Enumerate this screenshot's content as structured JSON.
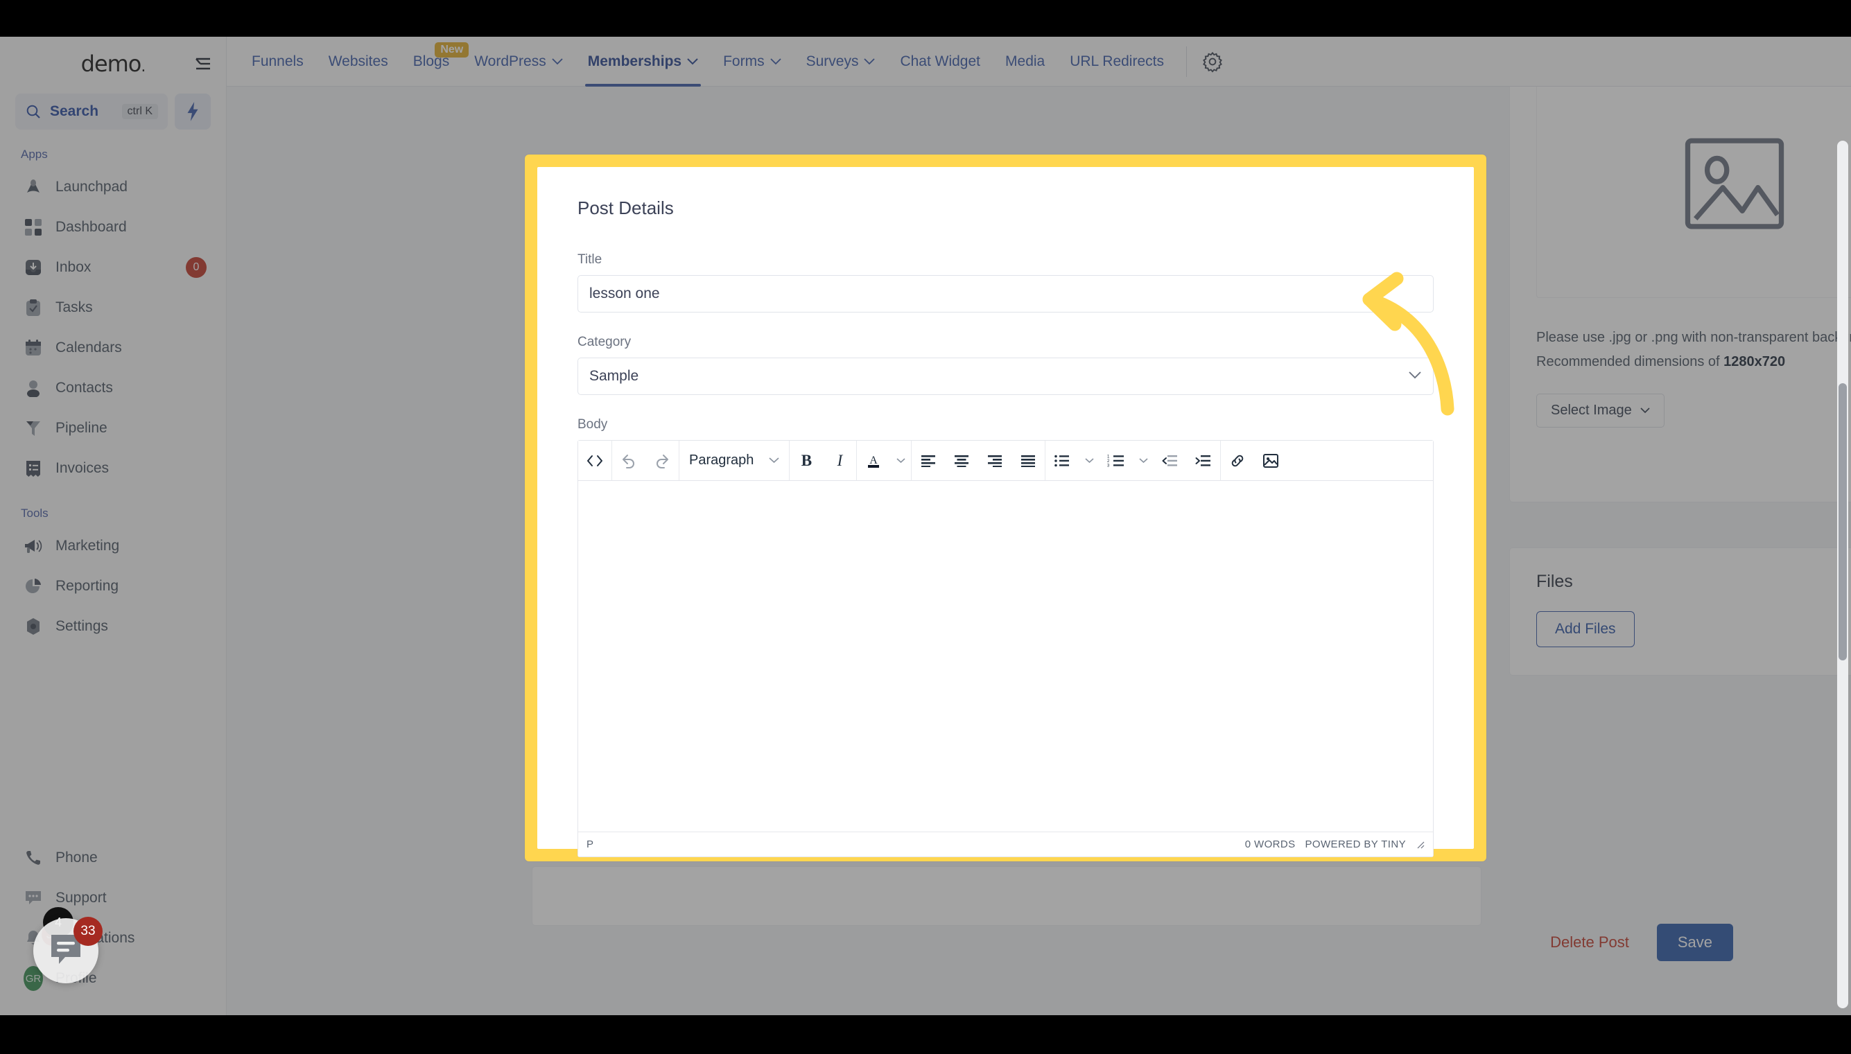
{
  "sidebar": {
    "logo": "demo",
    "logo_suffix": ".",
    "search": {
      "label": "Search",
      "shortcut": "ctrl K"
    },
    "sections": [
      {
        "label": "Apps",
        "items": [
          {
            "label": "Launchpad",
            "icon": "launchpad-icon",
            "badge": ""
          },
          {
            "label": "Dashboard",
            "icon": "dashboard-icon",
            "badge": ""
          },
          {
            "label": "Inbox",
            "icon": "inbox-icon",
            "badge": "0"
          },
          {
            "label": "Tasks",
            "icon": "tasks-icon",
            "badge": ""
          },
          {
            "label": "Calendars",
            "icon": "calendar-icon",
            "badge": ""
          },
          {
            "label": "Contacts",
            "icon": "contacts-icon",
            "badge": ""
          },
          {
            "label": "Pipeline",
            "icon": "pipeline-icon",
            "badge": ""
          },
          {
            "label": "Invoices",
            "icon": "invoices-icon",
            "badge": ""
          }
        ]
      },
      {
        "label": "Tools",
        "items": [
          {
            "label": "Marketing",
            "icon": "megaphone-icon",
            "badge": ""
          },
          {
            "label": "Reporting",
            "icon": "pie-chart-icon",
            "badge": ""
          },
          {
            "label": "Settings",
            "icon": "gear-icon",
            "badge": ""
          }
        ]
      }
    ],
    "bottom": [
      {
        "label": "Phone",
        "icon": "phone-icon",
        "badge": ""
      },
      {
        "label": "Support",
        "icon": "support-chat-icon",
        "badge": ""
      },
      {
        "label": "Notifications",
        "icon": "bell-icon",
        "badge": "33"
      },
      {
        "label": "Profile",
        "icon": "avatar-icon",
        "badge": "",
        "avatar_initials": "GR"
      }
    ]
  },
  "chat_widget": {
    "badge": "33",
    "mini_badge": "4"
  },
  "topnav": {
    "items": [
      {
        "label": "Funnels",
        "caret": false,
        "active": false,
        "badge": ""
      },
      {
        "label": "Websites",
        "caret": false,
        "active": false,
        "badge": ""
      },
      {
        "label": "Blogs",
        "caret": false,
        "active": false,
        "badge": "New"
      },
      {
        "label": "WordPress",
        "caret": true,
        "active": false,
        "badge": ""
      },
      {
        "label": "Memberships",
        "caret": true,
        "active": true,
        "badge": ""
      },
      {
        "label": "Forms",
        "caret": true,
        "active": false,
        "badge": ""
      },
      {
        "label": "Surveys",
        "caret": true,
        "active": false,
        "badge": ""
      },
      {
        "label": "Chat Widget",
        "caret": false,
        "active": false,
        "badge": ""
      },
      {
        "label": "Media",
        "caret": false,
        "active": false,
        "badge": ""
      },
      {
        "label": "URL Redirects",
        "caret": false,
        "active": false,
        "badge": ""
      }
    ],
    "settings_icon": "gear-icon"
  },
  "post_details": {
    "card_title": "Post Details",
    "title_label": "Title",
    "title_value": "lesson one",
    "title_placeholder": "Title",
    "category_label": "Category",
    "category_value": "Sample",
    "category_options": [
      "Sample"
    ],
    "body_label": "Body",
    "editor": {
      "format_select": "Paragraph",
      "buttons": [
        "source-code-icon",
        "undo-icon",
        "redo-icon",
        "bold-icon",
        "italic-icon",
        "text-color-icon",
        "align-left-icon",
        "align-center-icon",
        "align-right-icon",
        "align-justify-icon",
        "bullet-list-icon",
        "numbered-list-icon",
        "outdent-icon",
        "indent-icon",
        "link-icon",
        "image-icon"
      ],
      "body_value": "",
      "status_path": "P",
      "word_count": "0 WORDS",
      "branding": "POWERED BY TINY"
    }
  },
  "image_panel": {
    "placeholder_icon": "image-placeholder-icon",
    "hint_line_1": "Please use .jpg or .png with non-transparent background.",
    "hint_line_2_prefix": "Recommended dimensions of ",
    "hint_line_2_strong": "1280x720",
    "select_image_label": "Select Image"
  },
  "files_panel": {
    "title": "Files",
    "add_files_label": "Add Files"
  },
  "actions": {
    "delete_label": "Delete Post",
    "save_label": "Save"
  },
  "colors": {
    "highlight": "#ffd64f",
    "primary": "#2f5ca8",
    "danger": "#c0392b",
    "nav_link": "#3b5ba9",
    "badge_new": "#e0ac2b"
  }
}
